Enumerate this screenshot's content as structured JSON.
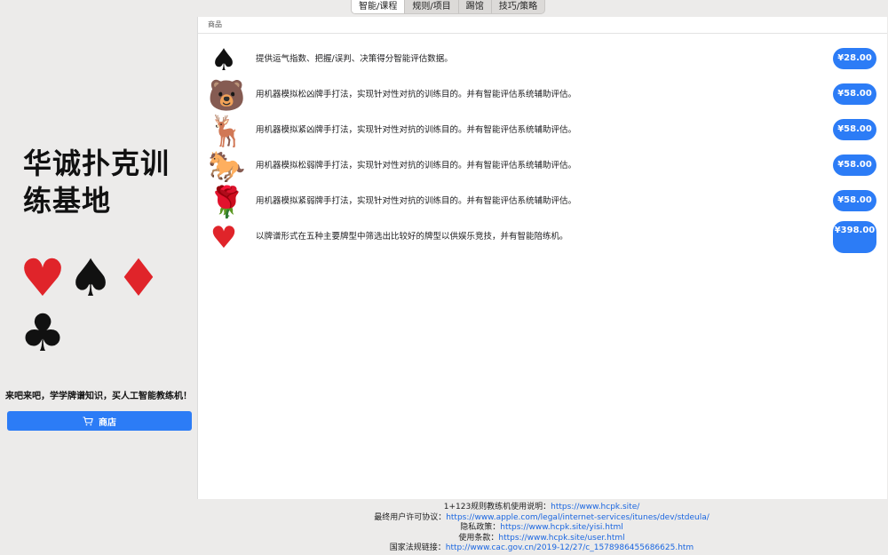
{
  "tabs": [
    "智能/课程",
    "规则/项目",
    "踢馆",
    "技巧/策略"
  ],
  "sidebar": {
    "title": "华诚扑克训练基地",
    "suits": [
      "♥",
      "♠",
      "♦",
      "♣"
    ],
    "slogan": "来吧来吧，学学牌谱知识，买人工智能教练机！",
    "shop_label": "商店"
  },
  "main": {
    "section_label": "商品",
    "items": [
      {
        "icon": "♠",
        "icon_name": "spade-icon",
        "desc": "提供运气指数、把握/误判、决策得分智能评估数据。",
        "price": "¥28.00"
      },
      {
        "icon": "🐻",
        "icon_name": "bear-icon",
        "desc": "用机器模拟松凶牌手打法，实现针对性对抗的训练目的。并有智能评估系统辅助评估。",
        "price": "¥58.00"
      },
      {
        "icon": "🦌",
        "icon_name": "deer-icon",
        "desc": "用机器模拟紧凶牌手打法，实现针对性对抗的训练目的。并有智能评估系统辅助评估。",
        "price": "¥58.00"
      },
      {
        "icon": "🐎",
        "icon_name": "horse-icon",
        "desc": "用机器模拟松弱牌手打法，实现针对性对抗的训练目的。并有智能评估系统辅助评估。",
        "price": "¥58.00"
      },
      {
        "icon": "🌹",
        "icon_name": "rose-icon",
        "desc": "用机器模拟紧弱牌手打法，实现针对性对抗的训练目的。并有智能评估系统辅助评估。",
        "price": "¥58.00"
      },
      {
        "icon": "♥",
        "icon_name": "heart-icon",
        "desc": "以牌谱形式在五种主要牌型中筛选出比较好的牌型以供娱乐竞技，并有智能陪练机。",
        "price": "¥398.00"
      }
    ]
  },
  "footer": {
    "lines": [
      {
        "label": "1+123规则教练机使用说明：",
        "link": "https://www.hcpk.site/"
      },
      {
        "label": "最终用户许可协议：",
        "link": "https://www.apple.com/legal/internet-services/itunes/dev/stdeula/"
      },
      {
        "label": "隐私政策：",
        "link": "https://www.hcpk.site/yisi.html"
      },
      {
        "label": "使用条款：",
        "link": "https://www.hcpk.site/user.html"
      },
      {
        "label": "国家法规链接：",
        "link": "http://www.cac.gov.cn/2019-12/27/c_1578986455686625.htm"
      }
    ]
  },
  "colors": {
    "accent": "#2c7cf6",
    "link": "#1a66e0",
    "heart": "#e0242a"
  }
}
